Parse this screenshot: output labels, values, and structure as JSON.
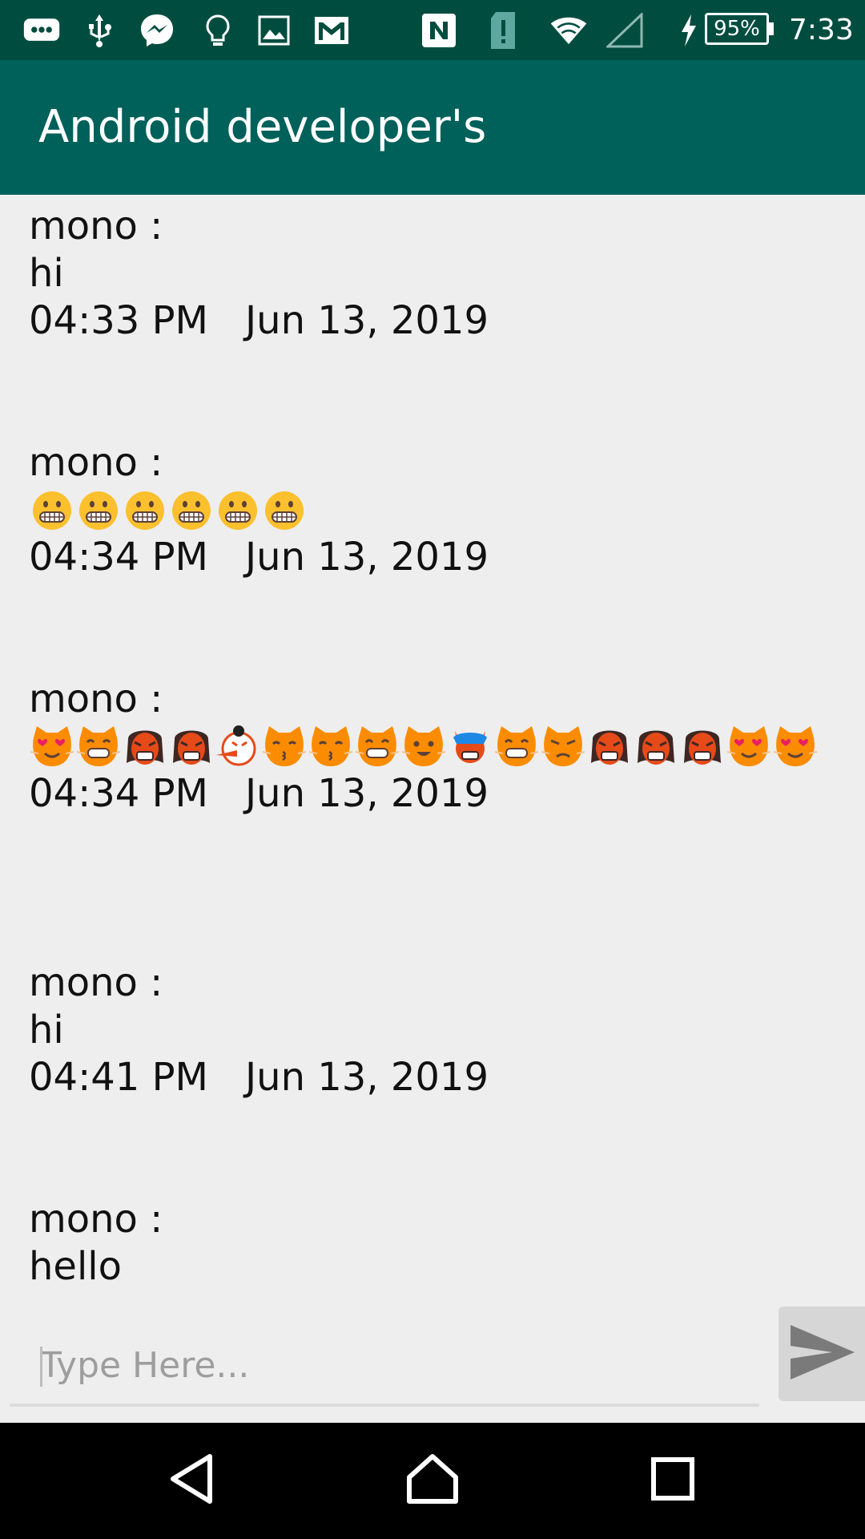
{
  "status_bar": {
    "left_icons": [
      "chat-bubble-icon",
      "usb-icon",
      "messenger-icon",
      "lightbulb-icon",
      "image-icon",
      "gmail-icon"
    ],
    "right_icons": [
      "nfc-icon",
      "sim-alert-icon",
      "wifi-icon",
      "cellular-signal-icon",
      "charging-icon"
    ],
    "battery_percent": "95%",
    "time": "7:33"
  },
  "app_bar": {
    "title": "Android developer's",
    "color": "#00605a"
  },
  "messages": [
    {
      "sender": "mono :",
      "text": "hi",
      "time": "04:33 PM",
      "date": "Jun 13, 2019"
    },
    {
      "sender": "mono :",
      "emojis": [
        "grimacing-face",
        "grimacing-face",
        "grimacing-face",
        "grimacing-face",
        "grimacing-face",
        "grimacing-face"
      ],
      "time": "04:34 PM",
      "date": "Jun 13, 2019"
    },
    {
      "sender": "mono :",
      "emojis": [
        "heart-eyes-cat",
        "grinning-cat",
        "ogre",
        "ogre",
        "tengu",
        "kissing-cat",
        "kissing-cat",
        "grinning-cat",
        "smiley-cat",
        "ogre-devil",
        "grinning-cat",
        "pouting-cat",
        "ogre",
        "ogre",
        "ogre",
        "heart-eyes-cat",
        "heart-eyes-cat"
      ],
      "time": "04:34 PM",
      "date": "Jun 13, 2019"
    },
    {
      "sender": "mono :",
      "text": "hi",
      "time": "04:41 PM",
      "date": "Jun 13, 2019"
    },
    {
      "sender": "mono :",
      "text": "hello"
    }
  ],
  "input": {
    "placeholder": "Type Here...",
    "value": ""
  },
  "send_button": {
    "icon": "send-icon"
  },
  "nav_bar": {
    "buttons": [
      "back-icon",
      "home-icon",
      "recents-icon"
    ]
  }
}
